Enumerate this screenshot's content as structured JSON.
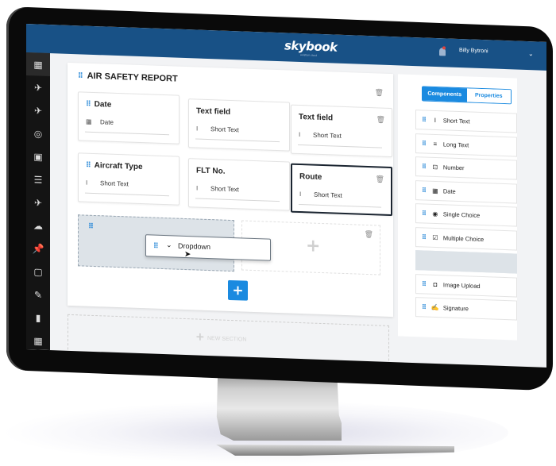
{
  "header": {
    "logo": "skybook",
    "logo_tagline": "aviation cloud",
    "user_name": "Billy Bytroni"
  },
  "sidebar": {
    "items": [
      {
        "icon": "grid-icon",
        "glyph": "▦",
        "active": true
      },
      {
        "icon": "airplane-icon",
        "glyph": "✈"
      },
      {
        "icon": "airplane-settings-icon",
        "glyph": "✈"
      },
      {
        "icon": "radar-icon",
        "glyph": "◎"
      },
      {
        "icon": "presentation-icon",
        "glyph": "▣"
      },
      {
        "icon": "list-box-icon",
        "glyph": "☰"
      },
      {
        "icon": "airplane-alert-icon",
        "glyph": "✈"
      },
      {
        "icon": "weather-icon",
        "glyph": "☁"
      },
      {
        "icon": "pin-icon",
        "glyph": "📌"
      },
      {
        "icon": "safe-icon",
        "glyph": "▢"
      },
      {
        "icon": "clipboard-edit-icon",
        "glyph": "✎"
      },
      {
        "icon": "bar-chart-icon",
        "glyph": "▮"
      },
      {
        "icon": "table-icon",
        "glyph": "▦"
      }
    ]
  },
  "form": {
    "title": "AIR SAFETY REPORT",
    "fields": [
      {
        "label": "Date",
        "value": "Date",
        "icon_glyph": "▦"
      },
      {
        "label": "Text field",
        "value": "Short Text",
        "icon_glyph": "I"
      },
      {
        "label": "Text field",
        "value": "Short Text",
        "icon_glyph": "I"
      },
      {
        "label": "Aircraft Type",
        "value": "Short Text",
        "icon_glyph": "I"
      },
      {
        "label": "FLT No.",
        "value": "Short Text",
        "icon_glyph": "I"
      },
      {
        "label": "Route",
        "value": "Short Text",
        "icon_glyph": "I"
      }
    ],
    "dragging_item": "Dropdown",
    "add_button": "+",
    "new_section_label": "NEW SECTION"
  },
  "panel": {
    "tabs": [
      {
        "label": "Components",
        "active": true
      },
      {
        "label": "Properties",
        "active": false
      }
    ],
    "components": [
      {
        "label": "Short Text",
        "glyph": "I"
      },
      {
        "label": "Long Text",
        "glyph": "≡"
      },
      {
        "label": "Number",
        "glyph": "⊡"
      },
      {
        "label": "Date",
        "glyph": "▦"
      },
      {
        "label": "Single Choice",
        "glyph": "◉"
      },
      {
        "label": "Multiple Choice",
        "glyph": "☑"
      },
      {
        "label": "",
        "placeholder": true
      },
      {
        "label": "Image Upload",
        "glyph": "◘"
      },
      {
        "label": "Signature",
        "glyph": "✍"
      }
    ]
  },
  "colors": {
    "brand_blue": "#185186",
    "accent": "#1a8ae0"
  }
}
